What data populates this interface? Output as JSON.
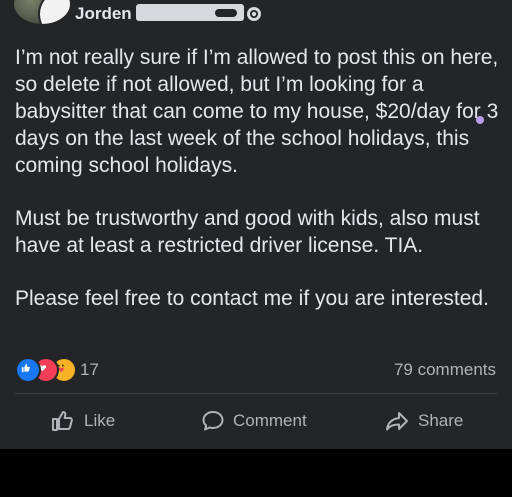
{
  "post": {
    "author": "Jorden",
    "paragraphs": [
      "I’m not really sure if I’m allowed to post this on here, so delete if not allowed, but I’m looking for a babysitter that can come to my house, $20/day for 3 days on the last week of the school holidays, this coming school holidays.",
      "Must be trustworthy and good with kids, also must have at least a restricted driver license. TIA.",
      "Please feel free to contact me if you are interested."
    ]
  },
  "reactions": {
    "icons": [
      "like-reaction-icon",
      "love-reaction-icon",
      "care-reaction-icon"
    ],
    "count": "17",
    "comments": "79 comments"
  },
  "actions": {
    "like": "Like",
    "comment": "Comment",
    "share": "Share"
  },
  "colors": {
    "post_bg": "#242526",
    "text": "#e4e6eb",
    "secondary_text": "#b0b3b8",
    "like_blue": "#1877f2",
    "love_red": "#f33e58",
    "care_yellow": "#f7b125"
  }
}
